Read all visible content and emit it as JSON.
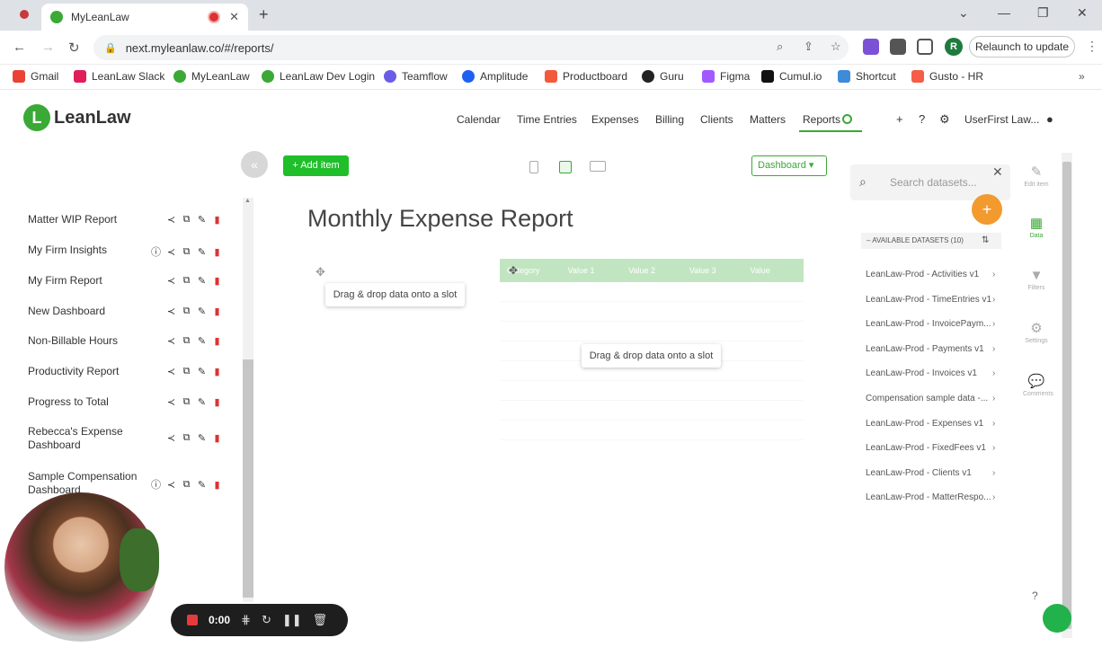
{
  "browser": {
    "tab_title": "MyLeanLaw",
    "url": "next.myleanlaw.co/#/reports/",
    "relaunch": "Relaunch to update",
    "profile_initial": "R",
    "bookmarks": [
      "Gmail",
      "LeanLaw Slack",
      "MyLeanLaw",
      "LeanLaw Dev Login",
      "Teamflow",
      "Amplitude",
      "Productboard",
      "Guru",
      "Figma",
      "Cumul.io",
      "Shortcut",
      "Gusto - HR"
    ]
  },
  "app": {
    "logo": "LeanLaw",
    "nav": [
      "Calendar",
      "Time Entries",
      "Expenses",
      "Billing",
      "Clients",
      "Matters",
      "Reports"
    ],
    "active_nav": "Reports",
    "user": "UserFirst Law..."
  },
  "sidebar": {
    "items": [
      {
        "label": "Matter WIP Report",
        "info": false
      },
      {
        "label": "My Firm Insights",
        "info": true
      },
      {
        "label": "My Firm Report",
        "info": false
      },
      {
        "label": "New Dashboard",
        "info": false
      },
      {
        "label": "Non-Billable Hours",
        "info": false
      },
      {
        "label": "Productivity Report",
        "info": false
      },
      {
        "label": "Progress to Total",
        "info": false
      },
      {
        "label": "Rebecca's Expense Dashboard",
        "info": false
      },
      {
        "label": "Sample Compensation Dashboard",
        "info": true
      }
    ]
  },
  "editor": {
    "add_item": "Add item",
    "dashboard_select": "Dashboard",
    "title": "Monthly Expense Report",
    "slot_hint_1": "Drag & drop data onto a slot",
    "slot_hint_2": "Drag & drop data onto a slot",
    "table_headers": [
      "Category",
      "Value 1",
      "Value 2",
      "Value 3",
      "Value"
    ]
  },
  "datasets": {
    "search_placeholder": "Search datasets...",
    "header": "AVAILABLE DATASETS (10)",
    "items": [
      "LeanLaw-Prod - Activities v1",
      "LeanLaw-Prod - TimeEntries v1",
      "LeanLaw-Prod - InvoicePaym...",
      "LeanLaw-Prod - Payments v1",
      "LeanLaw-Prod - Invoices v1",
      "Compensation sample data -...",
      "LeanLaw-Prod - Expenses v1",
      "LeanLaw-Prod - FixedFees v1",
      "LeanLaw-Prod - Clients v1",
      "LeanLaw-Prod - MatterRespo..."
    ]
  },
  "rail": [
    "Edit item",
    "Data",
    "Filters",
    "Settings",
    "Comments"
  ],
  "recorder": {
    "time": "0:00"
  },
  "colors": {
    "brand": "#3aa935",
    "add": "#1fbf2a",
    "fab": "#f29a2e",
    "delete": "#dd3333"
  }
}
